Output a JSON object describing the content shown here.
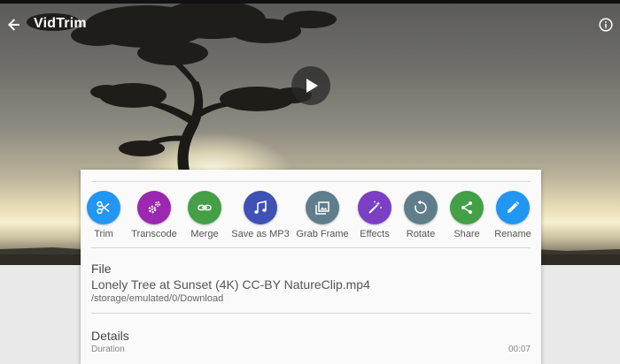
{
  "appbar": {
    "title": "VidTrim",
    "back_icon": "arrow-left-icon",
    "info_icon": "info-icon"
  },
  "player": {
    "play_icon": "play-icon"
  },
  "actions": [
    {
      "label": "Trim",
      "icon": "scissors-icon",
      "color": "#2196F3"
    },
    {
      "label": "Transcode",
      "icon": "gears-icon",
      "color": "#9C27B0"
    },
    {
      "label": "Merge",
      "icon": "link-icon",
      "color": "#43A047"
    },
    {
      "label": "Save as MP3",
      "icon": "music-icon",
      "color": "#3F51B5"
    },
    {
      "label": "Grab Frame",
      "icon": "image-icon",
      "color": "#607D8B"
    },
    {
      "label": "Effects",
      "icon": "magic-wand-icon",
      "color": "#7B3FC4"
    },
    {
      "label": "Rotate",
      "icon": "rotate-icon",
      "color": "#607D8B"
    },
    {
      "label": "Share",
      "icon": "share-icon",
      "color": "#43A047"
    },
    {
      "label": "Rename",
      "icon": "pencil-icon",
      "color": "#2196F3"
    }
  ],
  "file": {
    "heading": "File",
    "name": "Lonely Tree at Sunset (4K) CC-BY NatureClip.mp4",
    "path": "/storage/emulated/0/Download"
  },
  "details": {
    "heading": "Details",
    "rows": [
      {
        "key": "Duration",
        "value": "00:07"
      }
    ]
  }
}
